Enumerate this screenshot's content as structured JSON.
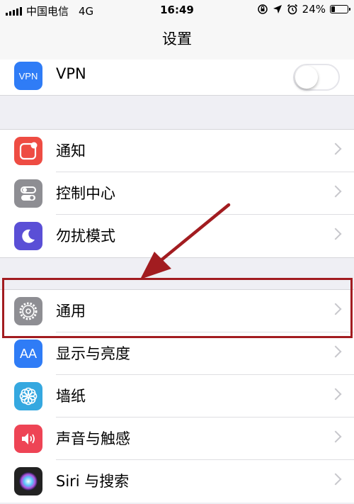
{
  "status": {
    "carrier": "中国电信",
    "network": "4G",
    "time": "16:49",
    "battery_text": "24%",
    "battery_level_pct": 24
  },
  "nav": {
    "title": "设置"
  },
  "groups": [
    [
      {
        "label": "VPN",
        "icon": "vpn-icon",
        "icon_text": "VPN",
        "color": "#2f7cf6",
        "toggle": false
      }
    ],
    [
      {
        "label": "通知",
        "icon": "notifications-icon",
        "color": "#ee4c43"
      },
      {
        "label": "控制中心",
        "icon": "control-center-icon",
        "color": "#8e8e93"
      },
      {
        "label": "勿扰模式",
        "icon": "moon-icon",
        "color": "#5a4fd6"
      }
    ],
    [
      {
        "label": "通用",
        "icon": "gear-icon",
        "color": "#8e8e93",
        "highlighted": true
      },
      {
        "label": "显示与亮度",
        "icon": "display-brightness-icon",
        "icon_text": "AA",
        "color": "#2f7cf6"
      },
      {
        "label": "墙纸",
        "icon": "wallpaper-icon",
        "color": "#35a8e0"
      },
      {
        "label": "声音与触感",
        "icon": "sound-icon",
        "color": "#ee4455"
      },
      {
        "label": "Siri 与搜索",
        "icon": "siri-icon",
        "color": "#222222"
      }
    ]
  ]
}
